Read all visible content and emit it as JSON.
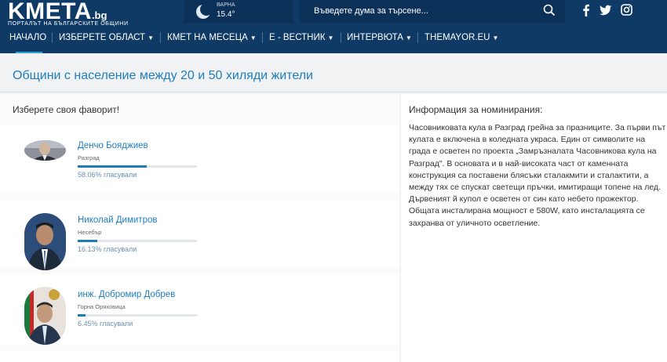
{
  "header": {
    "logo_main": "KMETA",
    "logo_suffix": ".bg",
    "logo_tagline": "ПОРТАЛЪТ НА БЪЛГАРСКИТЕ ОБЩИНИ",
    "weather": {
      "city": "ВАРНА",
      "temp": "15.4°",
      "icon": "moon-icon"
    },
    "search": {
      "placeholder": "Въведете дума за търсене..."
    },
    "social": [
      "facebook-icon",
      "twitter-icon",
      "instagram-icon"
    ]
  },
  "nav": {
    "items": [
      {
        "label": "НАЧАЛО"
      },
      {
        "label": "ИЗБЕРЕТЕ ОБЛАСТ"
      },
      {
        "label": "КМЕТ НА МЕСЕЦА"
      },
      {
        "label": "Е - ВЕСТНИК"
      },
      {
        "label": "ИНТЕРВЮТА"
      },
      {
        "label": "THEMAYOR.EU"
      }
    ]
  },
  "page": {
    "title": "Общини с население между 20 и 50 хиляди жители"
  },
  "vote": {
    "heading": "Изберете своя фаворит!",
    "candidates": [
      {
        "name": "Денчо Бояджиев",
        "town": "Разград",
        "percent_label": "58.06% гласували",
        "share": 0.5806
      },
      {
        "name": "Николай Димитров",
        "town": "Несебър",
        "percent_label": "16.13% гласували",
        "share": 0.1613
      },
      {
        "name": "инж. Добромир Добрев",
        "town": "Горна Оряховица",
        "percent_label": "6.45% гласували",
        "share": 0.0645
      }
    ]
  },
  "info": {
    "title": "Информация за номинирания:",
    "text": "Часовниковата кула в Разград грейна за празниците. За първи път кулата е включена в коледната украса. Един от символите на града е осветен по проекта „Замръзналата Часовникова кула на Разград\". В основата и в най-високата част от каменната конструкция са поставени блясъки сталакмити и сталактити, а между тях се спускат светещи пръчки, имитиращи топене на лед. Дървеният й купол е осветен от син като небето прожектор. Общата инсталирана мощност е 580W, като инсталацията се захранва от уличното осветление."
  },
  "colors": {
    "header": "#0f3a66",
    "accent": "#1f7dbf",
    "bar": "#1f7db5"
  }
}
